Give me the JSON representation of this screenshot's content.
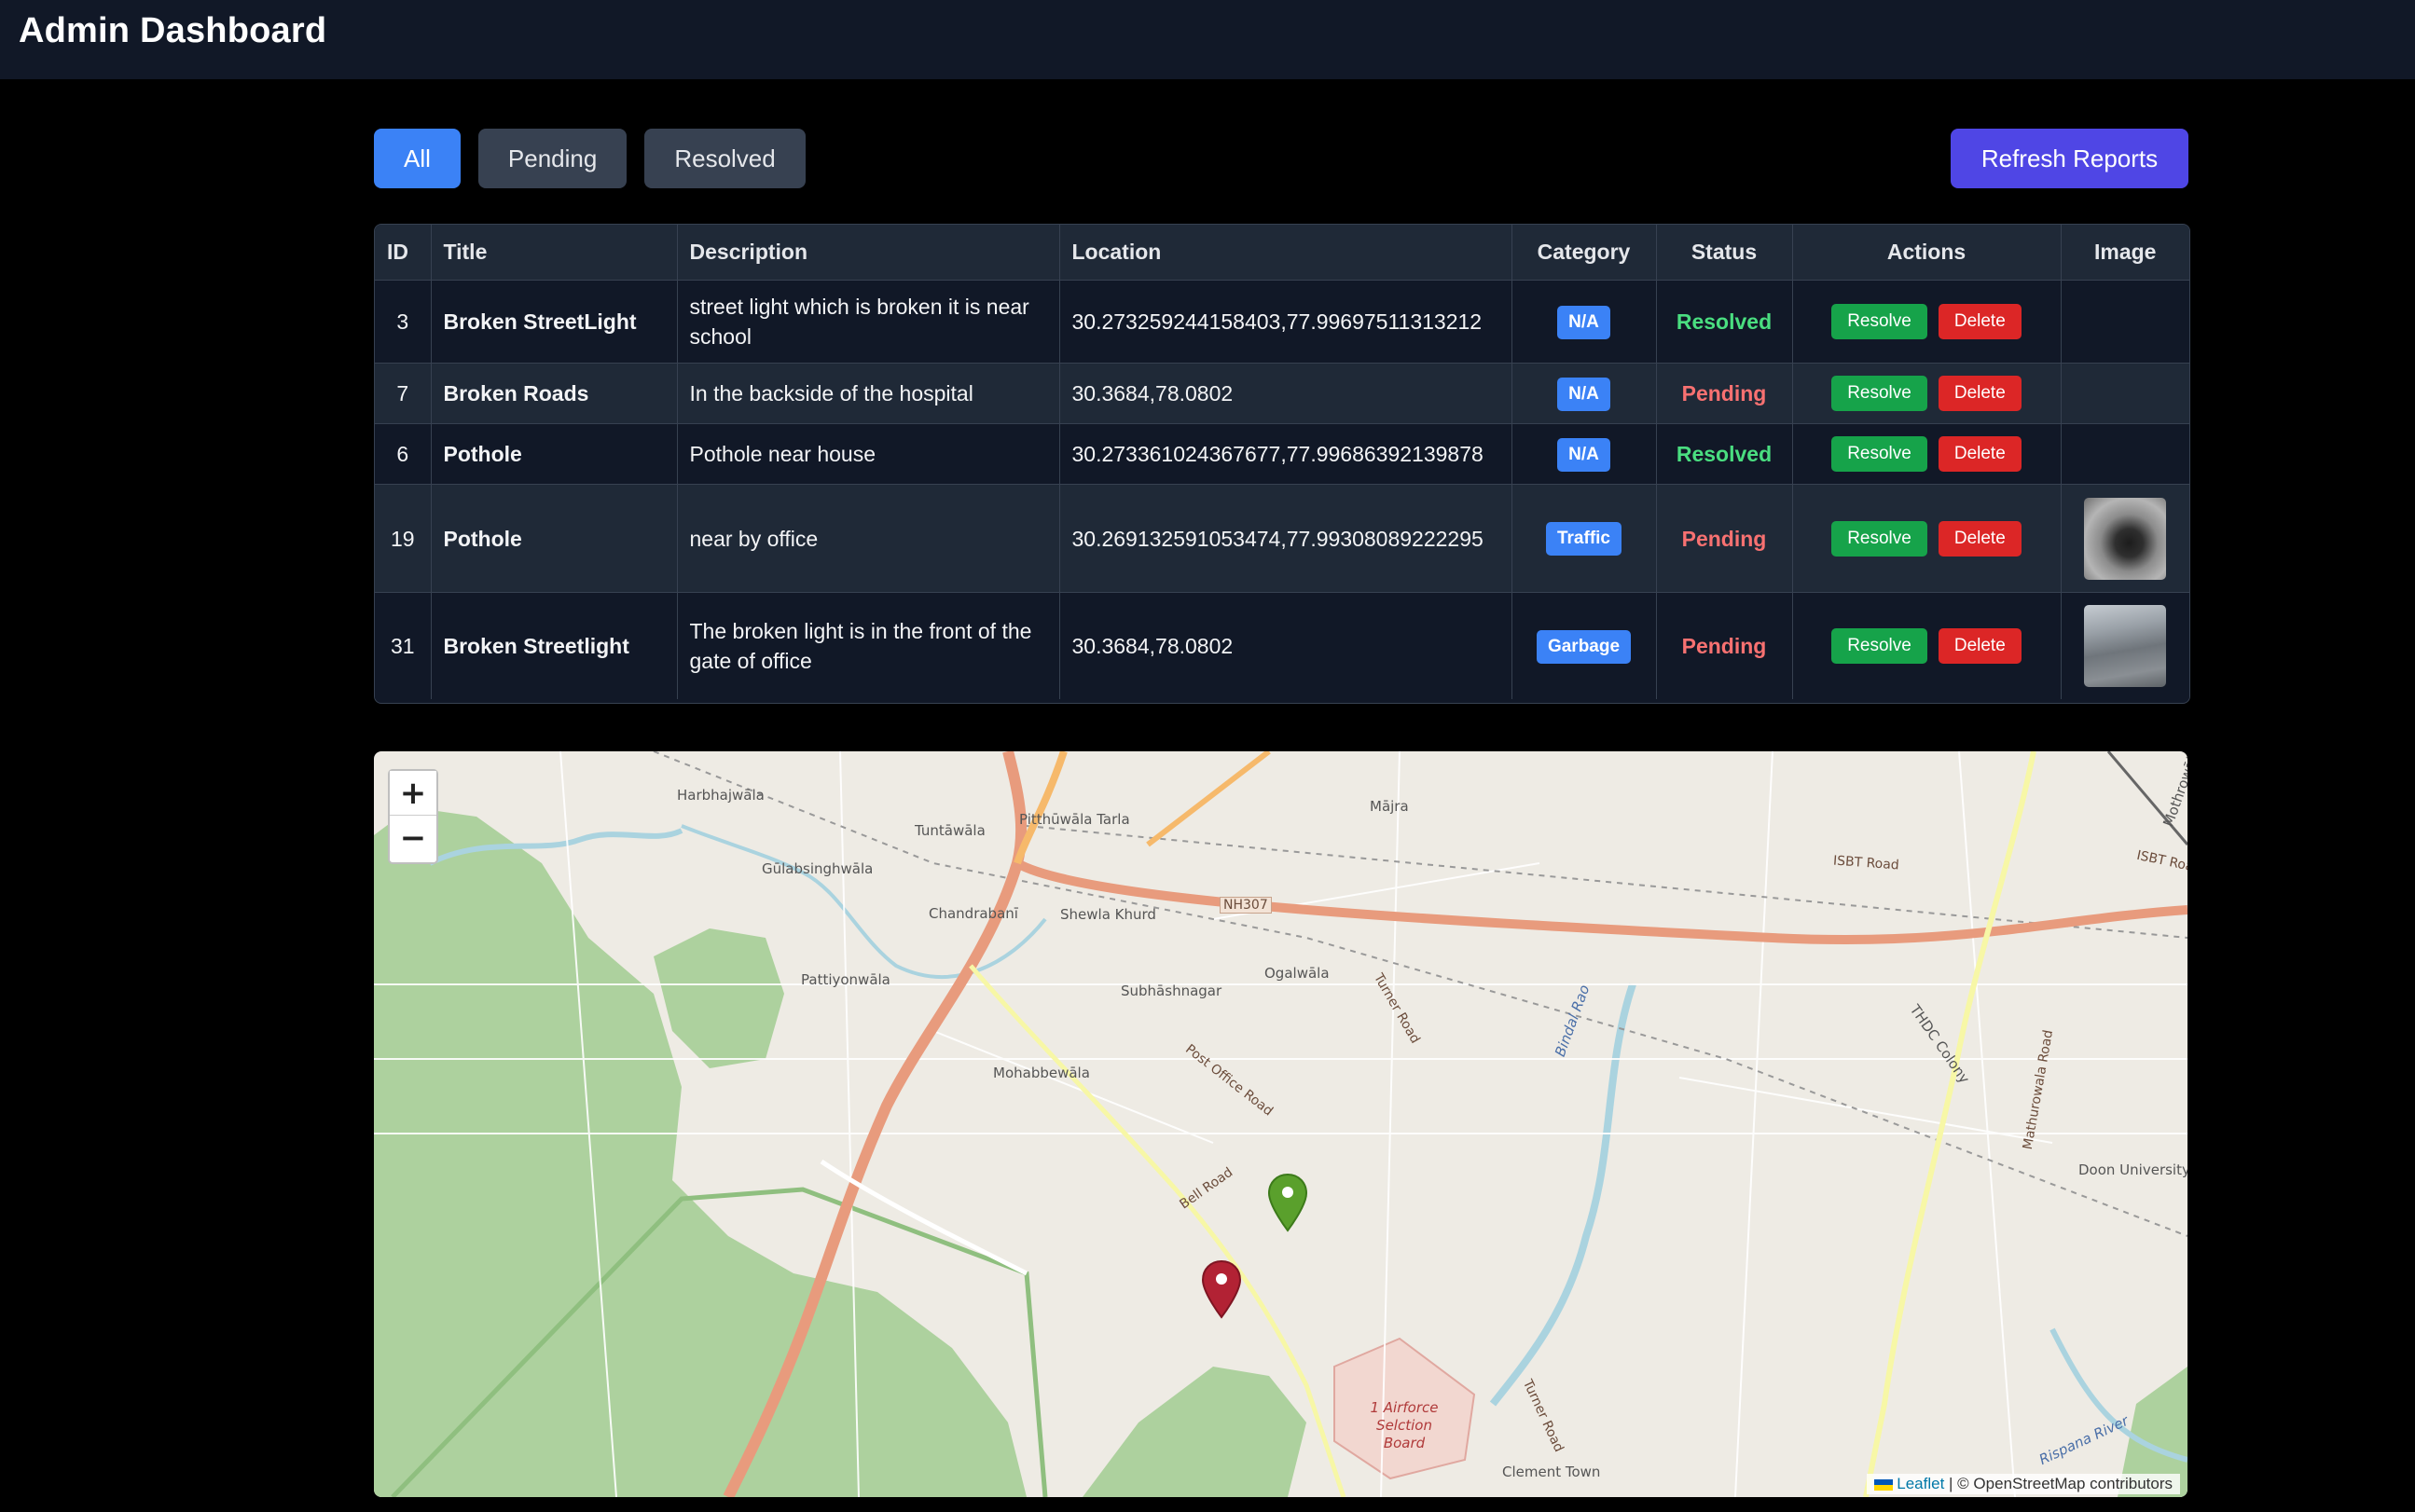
{
  "header": {
    "title": "Admin Dashboard"
  },
  "filters": [
    {
      "label": "All",
      "active": true
    },
    {
      "label": "Pending",
      "active": false
    },
    {
      "label": "Resolved",
      "active": false
    }
  ],
  "refresh_label": "Refresh Reports",
  "table": {
    "columns": [
      "ID",
      "Title",
      "Description",
      "Location",
      "Category",
      "Status",
      "Actions",
      "Image"
    ],
    "resolve_label": "Resolve",
    "delete_label": "Delete",
    "rows": [
      {
        "id": "3",
        "title": "Broken StreetLight",
        "description": "street light which is broken it is near school",
        "location": "30.273259244158403,77.99697511313212",
        "category": "N/A",
        "status": "Resolved",
        "image": ""
      },
      {
        "id": "7",
        "title": "Broken Roads",
        "description": "In the backside of the hospital",
        "location": "30.3684,78.0802",
        "category": "N/A",
        "status": "Pending",
        "image": ""
      },
      {
        "id": "6",
        "title": "Pothole",
        "description": "Pothole near house",
        "location": "30.273361024367677,77.99686392139878",
        "category": "N/A",
        "status": "Resolved",
        "image": ""
      },
      {
        "id": "19",
        "title": "Pothole",
        "description": "near by office",
        "location": "30.269132591053474,77.99308089222295",
        "category": "Traffic",
        "status": "Pending",
        "image": "pothole-photo"
      },
      {
        "id": "31",
        "title": "Broken Streetlight",
        "description": "The broken light is in the front of the gate of office",
        "location": "30.3684,78.0802",
        "category": "Garbage",
        "status": "Pending",
        "image": "road-photo"
      }
    ]
  },
  "map": {
    "zoom_in": "+",
    "zoom_out": "−",
    "attribution_link": "Leaflet",
    "attribution_text": "| © OpenStreetMap contributors",
    "places": {
      "harbhajwala": "Harbhajwāla",
      "pitthuwala": "Pitthūwāla Tarla",
      "tuntawala": "Tuntāwāla",
      "majra": "Mājra",
      "gulabsinghwala": "Gūlabsinghwāla",
      "chandrabani": "Chandrabanī",
      "shewla": "Shewla Khurd",
      "nh307": "NH307",
      "isbt1": "ISBT Road",
      "isbt2": "ISBT Roa",
      "thdc": "THDC Colony",
      "mothrowala": "Mothrowāla",
      "pattiyonwala": "Pattiyonwāla",
      "ogalwala": "Ogalwāla",
      "turner1": "Turner Road",
      "subhashnagar": "Subhāshnagar",
      "bindal": "Bindal Rao",
      "mathurowala": "Mathurowala Road",
      "postoffice": "Post Office Road",
      "mohabbewala": "Mohabbewāla",
      "doon": "Doon University",
      "bell": "Bell Road",
      "airforce": "1 Airforce Selction Board",
      "turner2": "Turner Road",
      "rispana": "Rispana River",
      "clement": "Clement Town"
    },
    "markers": [
      {
        "color": "#5aa02c",
        "status": "Resolved"
      },
      {
        "color": "#b22234",
        "status": "Pending"
      }
    ]
  }
}
